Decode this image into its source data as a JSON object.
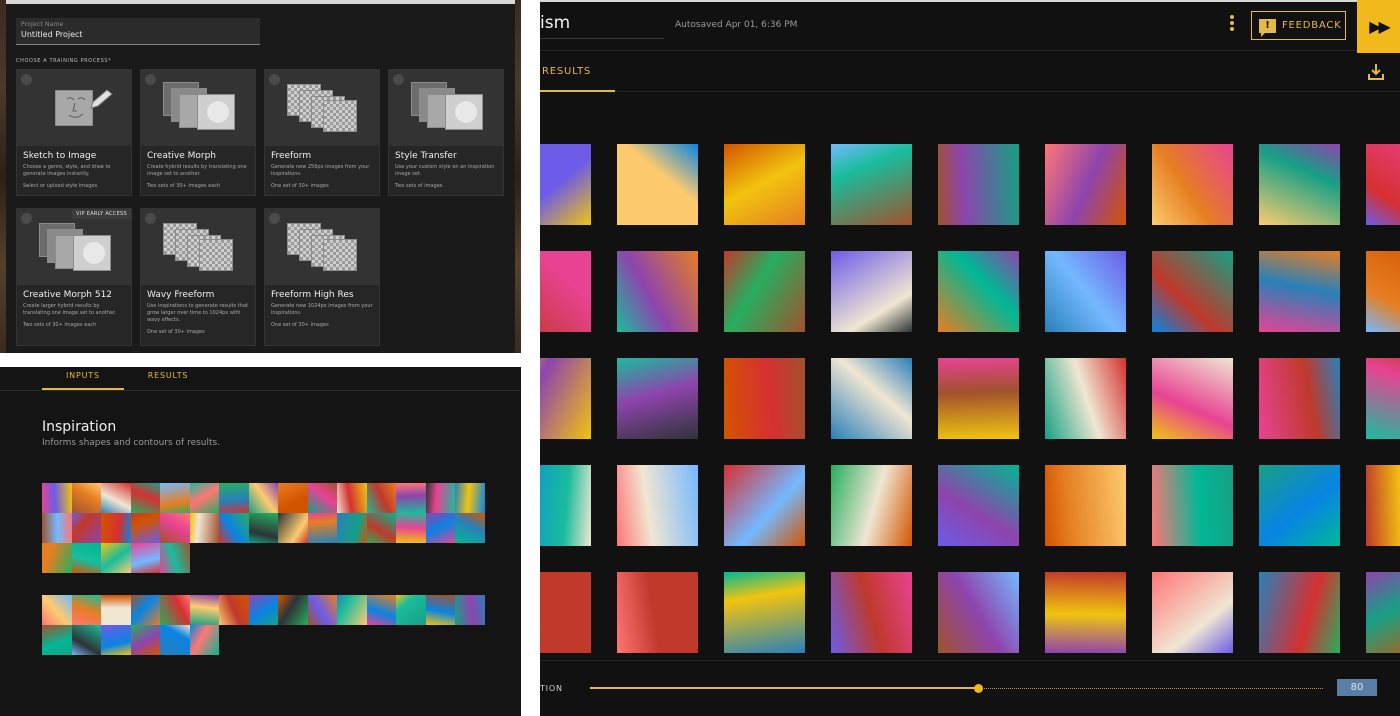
{
  "training_panel": {
    "project_field_label": "Project Name",
    "project_field_value": "Untitled Project",
    "choose_label": "CHOOSE A TRAINING PROCESS*",
    "cards": [
      {
        "title": "Sketch to Image",
        "desc": "Choose a genre, style, and draw to generate images instantly.",
        "req": "Select or upload style images.",
        "badge": ""
      },
      {
        "title": "Creative Morph",
        "desc": "Create hybrid results by translating one image set to another.",
        "req": "Two sets of 30+ images each",
        "badge": ""
      },
      {
        "title": "Freeform",
        "desc": "Generate new 256px images from your inspirations.",
        "req": "One set of 30+ images",
        "badge": ""
      },
      {
        "title": "Style Transfer",
        "desc": "Use your custom style on an inspiration image set.",
        "req": "Two sets of images",
        "badge": ""
      },
      {
        "title": "Creative Morph 512",
        "desc": "Create larger hybrid results by translating one image set to another.",
        "req": "Two sets of 30+ images each",
        "badge": "VIP EARLY ACCESS"
      },
      {
        "title": "Wavy Freeform",
        "desc": "Use inspirations to generate results that grow larger over time to 1024px with wavy effects.",
        "req": "One set of 30+ images",
        "badge": ""
      },
      {
        "title": "Freeform High Res",
        "desc": "Generate new 1024px images from your inspirations.",
        "req": "One set of 30+ images",
        "badge": ""
      }
    ]
  },
  "inputs_panel": {
    "tabs": [
      "INPUTS",
      "RESULTS"
    ],
    "section_title": "Inspiration",
    "section_subtitle": "Informs shapes and contours of results."
  },
  "results_panel": {
    "project_title": "ism",
    "autosave": "Autosaved Apr 01, 6:36 PM",
    "feedback_label": "FEEDBACK",
    "forward_label": "▶▶",
    "results_tab": "RESULTS",
    "slider_label": "TION",
    "slider_value": "80",
    "slider_fraction": 0.53
  },
  "colors": {
    "accent": "#e6b84a",
    "accent_bright": "#f2b91c",
    "bg_dark": "#111111",
    "value_box": "#5a7ea6"
  },
  "icons": {
    "feedback": "exclamation-speech-icon",
    "forward": "fast-forward-icon",
    "download": "download-tray-icon",
    "menu": "kebab-menu-icon"
  }
}
